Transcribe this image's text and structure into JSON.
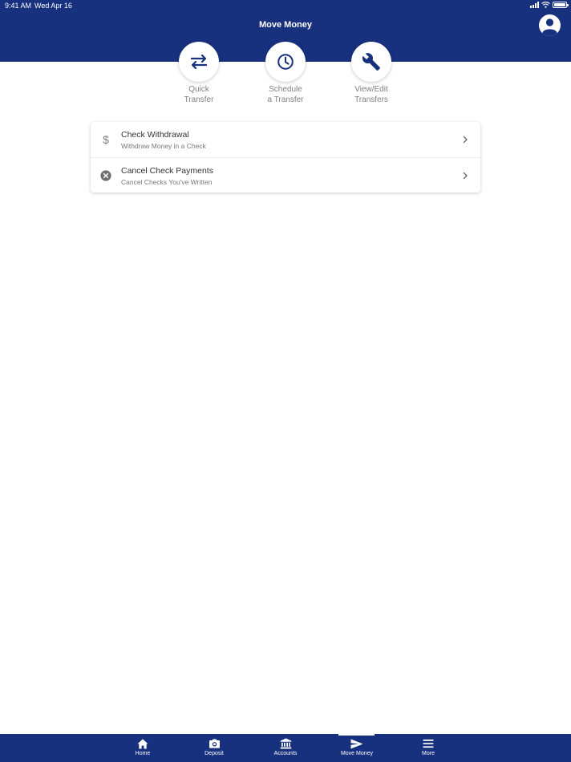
{
  "status_bar": {
    "time": "9:41 AM",
    "date": "Wed Apr 16"
  },
  "header": {
    "title": "Move Money",
    "profile_icon": "user-circle-icon"
  },
  "quick_actions": [
    {
      "line1": "Quick",
      "line2": "Transfer",
      "icon": "transfer-arrows-icon"
    },
    {
      "line1": "Schedule",
      "line2": "a Transfer",
      "icon": "clock-icon"
    },
    {
      "line1": "View/Edit",
      "line2": "Transfers",
      "icon": "wrench-icon"
    }
  ],
  "menu": [
    {
      "title": "Check Withdrawal",
      "subtitle": "Withdraw Money in a Check",
      "icon": "dollar-icon"
    },
    {
      "title": "Cancel Check Payments",
      "subtitle": "Cancel Checks You've Written",
      "icon": "cancel-circle-icon"
    }
  ],
  "tabs": [
    {
      "label": "Home",
      "icon": "home-icon"
    },
    {
      "label": "Deposit",
      "icon": "camera-icon"
    },
    {
      "label": "Accounts",
      "icon": "bank-icon"
    },
    {
      "label": "Move Money",
      "icon": "send-icon",
      "active": true
    },
    {
      "label": "More",
      "icon": "menu-icon"
    }
  ],
  "colors": {
    "brand": "#17317e",
    "label_gray": "#808080",
    "background": "#ffffff"
  }
}
